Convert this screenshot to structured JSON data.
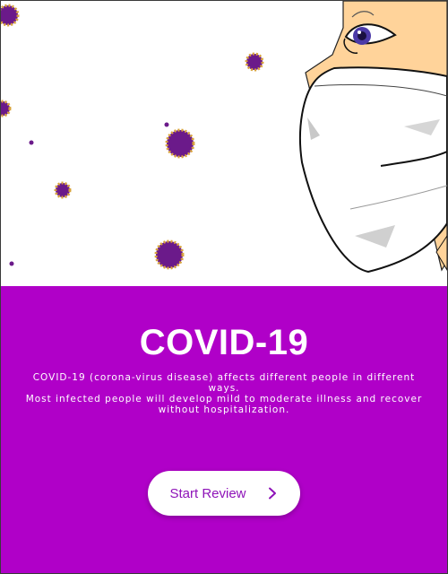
{
  "colors": {
    "panel_bg": "#b000c8",
    "accent_text": "#8e13b8",
    "virus": "#6b1a8a",
    "virus_spikes": "#d9a43a",
    "skin": "#ffd39a",
    "mask": "#ffffff"
  },
  "hero": {
    "illustration": "woman-with-face-mask-and-virus-particles"
  },
  "content": {
    "title": "COVID-19",
    "description": "COVID-19 (corona-virus disease)  affects different people in different ways.\nMost infected people will develop mild to moderate illness and recover\nwithout hospitalization."
  },
  "actions": {
    "start_label": "Start Review",
    "start_icon": "chevron-right-icon"
  }
}
